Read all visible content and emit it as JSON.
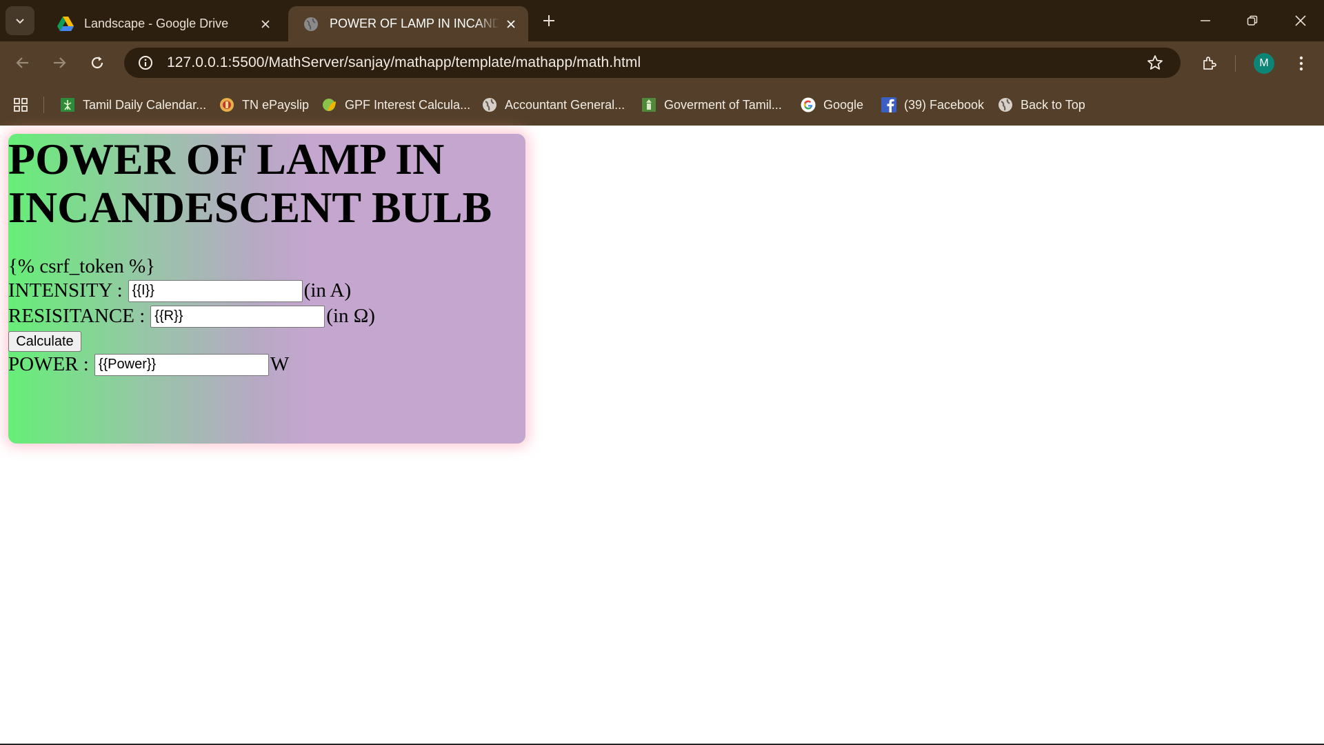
{
  "browser": {
    "tabs": [
      {
        "title": "Landscape - Google Drive",
        "icon": "google-drive-icon",
        "active": false
      },
      {
        "title": "POWER OF LAMP IN INCANDESCENT BULB",
        "icon": "globe-icon",
        "active": true
      }
    ],
    "url_host": "127.0.0.1",
    "url_rest": ":5500/MathServer/sanjay/mathapp/template/mathapp/math.html",
    "profile_initial": "M",
    "bookmarks": [
      {
        "label": "Tamil Daily Calendar...",
        "icon": "calendar-icon"
      },
      {
        "label": "TN ePayslip",
        "icon": "emblem-icon"
      },
      {
        "label": "GPF Interest Calcula...",
        "icon": "leaf-icon"
      },
      {
        "label": "Accountant General...",
        "icon": "globe-icon"
      },
      {
        "label": "Goverment of Tamil...",
        "icon": "emblem-icon"
      },
      {
        "label": "Google",
        "icon": "google-icon"
      },
      {
        "label": "(39) Facebook",
        "icon": "facebook-icon"
      },
      {
        "label": "Back to Top",
        "icon": "globe-icon"
      }
    ]
  },
  "page": {
    "heading": "POWER OF LAMP IN INCANDESCENT BULB",
    "csrf_text": "{% csrf_token %}",
    "intensity_label": "INTENSITY :",
    "intensity_value": "{{I}}",
    "intensity_unit": "(in A)",
    "resistance_label": "RESISITANCE :",
    "resistance_value": "{{R}}",
    "resistance_unit": "(in Ω)",
    "calculate_label": "Calculate",
    "power_label": "POWER :",
    "power_value": "{{Power}}",
    "power_unit": "W"
  },
  "colors": {
    "card_gradient_start": "#66ee77",
    "card_gradient_end": "#c4a6ce",
    "card_glow": "#ff96aa",
    "chrome_dark": "#2d1f0f",
    "chrome_light": "#54402a"
  }
}
